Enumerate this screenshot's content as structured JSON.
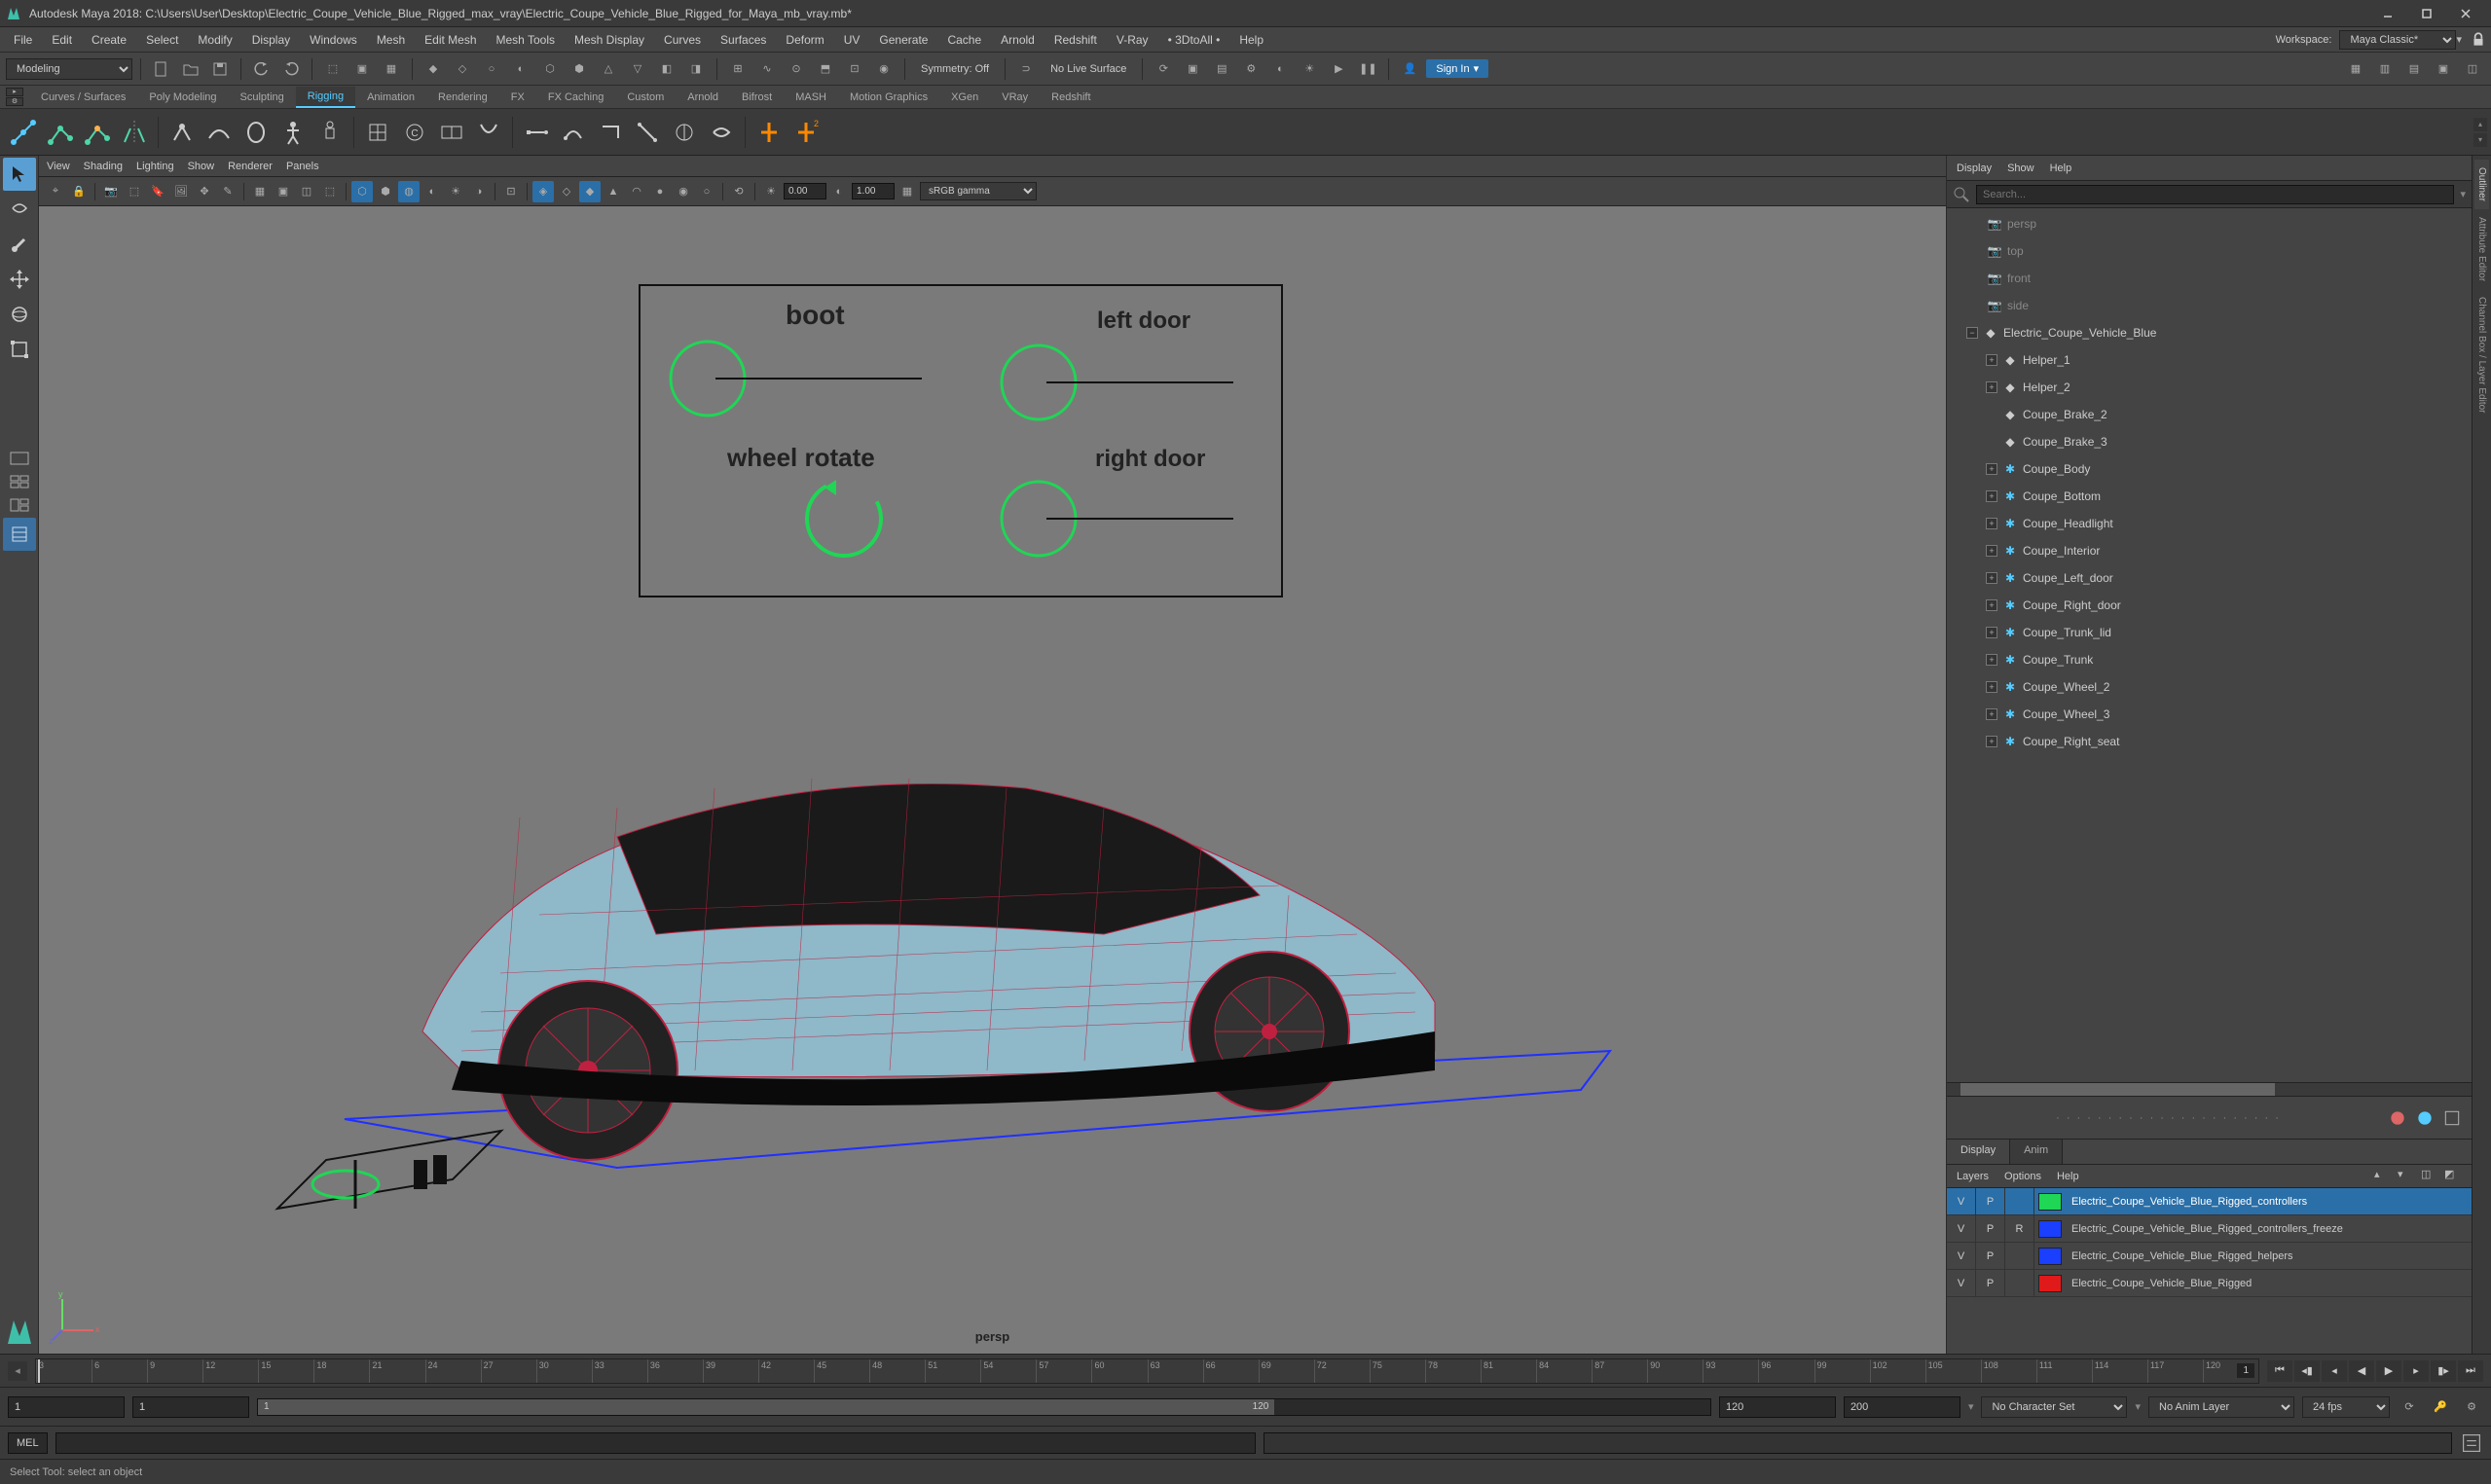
{
  "window": {
    "title": "Autodesk Maya 2018: C:\\Users\\User\\Desktop\\Electric_Coupe_Vehicle_Blue_Rigged_max_vray\\Electric_Coupe_Vehicle_Blue_Rigged_for_Maya_mb_vray.mb*"
  },
  "menus": [
    "File",
    "Edit",
    "Create",
    "Select",
    "Modify",
    "Display",
    "Windows",
    "Mesh",
    "Edit Mesh",
    "Mesh Tools",
    "Mesh Display",
    "Curves",
    "Surfaces",
    "Deform",
    "UV",
    "Generate",
    "Cache",
    "Arnold",
    "Redshift",
    "V-Ray",
    "• 3DtoAll •",
    "Help"
  ],
  "workspace": {
    "label": "Workspace:",
    "value": "Maya Classic*"
  },
  "statusline": {
    "module": "Modeling",
    "symmetry": "Symmetry: Off",
    "surface": "No Live Surface",
    "signin": "Sign In"
  },
  "shelf_tabs": [
    "Curves / Surfaces",
    "Poly Modeling",
    "Sculpting",
    "Rigging",
    "Animation",
    "Rendering",
    "FX",
    "FX Caching",
    "Custom",
    "Arnold",
    "Bifrost",
    "MASH",
    "Motion Graphics",
    "XGen",
    "VRay",
    "Redshift"
  ],
  "shelf_active": "Rigging",
  "viewport": {
    "menus": [
      "View",
      "Shading",
      "Lighting",
      "Show",
      "Renderer",
      "Panels"
    ],
    "near": "0.00",
    "far": "1.00",
    "colorspace": "sRGB gamma",
    "camera": "persp",
    "rig_labels": {
      "boot": "boot",
      "wheel": "wheel rotate",
      "left": "left door",
      "right": "right door"
    }
  },
  "outliner": {
    "menus": [
      "Display",
      "Show",
      "Help"
    ],
    "search_placeholder": "Search...",
    "cameras": [
      "persp",
      "top",
      "front",
      "side"
    ],
    "root": "Electric_Coupe_Vehicle_Blue",
    "helpers": [
      "Helper_1",
      "Helper_2",
      "Coupe_Brake_2",
      "Coupe_Brake_3"
    ],
    "meshes": [
      "Coupe_Body",
      "Coupe_Bottom",
      "Coupe_Headlight",
      "Coupe_Interior",
      "Coupe_Left_door",
      "Coupe_Right_door",
      "Coupe_Trunk_lid",
      "Coupe_Trunk",
      "Coupe_Wheel_2",
      "Coupe_Wheel_3",
      "Coupe_Right_seat"
    ]
  },
  "layereditor": {
    "tabs": [
      "Display",
      "Anim"
    ],
    "menus": [
      "Layers",
      "Options",
      "Help"
    ],
    "layers": [
      {
        "v": "V",
        "p": "P",
        "r": "",
        "color": "#1fd655",
        "name": "Electric_Coupe_Vehicle_Blue_Rigged_controllers",
        "sel": true
      },
      {
        "v": "V",
        "p": "P",
        "r": "R",
        "color": "#1a3fff",
        "name": "Electric_Coupe_Vehicle_Blue_Rigged_controllers_freeze"
      },
      {
        "v": "V",
        "p": "P",
        "r": "",
        "color": "#1a3fff",
        "name": "Electric_Coupe_Vehicle_Blue_Rigged_helpers"
      },
      {
        "v": "V",
        "p": "P",
        "r": "",
        "color": "#e01a1a",
        "name": "Electric_Coupe_Vehicle_Blue_Rigged"
      }
    ]
  },
  "timeline": {
    "ticks": [
      "3",
      "6",
      "9",
      "12",
      "15",
      "18",
      "21",
      "24",
      "27",
      "30",
      "33",
      "36",
      "39",
      "42",
      "45",
      "48",
      "51",
      "54",
      "57",
      "60",
      "63",
      "66",
      "69",
      "72",
      "75",
      "78",
      "81",
      "84",
      "87",
      "90",
      "93",
      "96",
      "99",
      "102",
      "105",
      "108",
      "111",
      "114",
      "117",
      "120"
    ],
    "current": "1"
  },
  "range": {
    "start_out": "1",
    "start_in": "1",
    "end_in": "120",
    "end_out": "120",
    "end_val": "200",
    "charset": "No Character Set",
    "animlayer": "No Anim Layer",
    "fps": "24 fps"
  },
  "cmd": {
    "lang": "MEL"
  },
  "status": "Select Tool: select an object"
}
